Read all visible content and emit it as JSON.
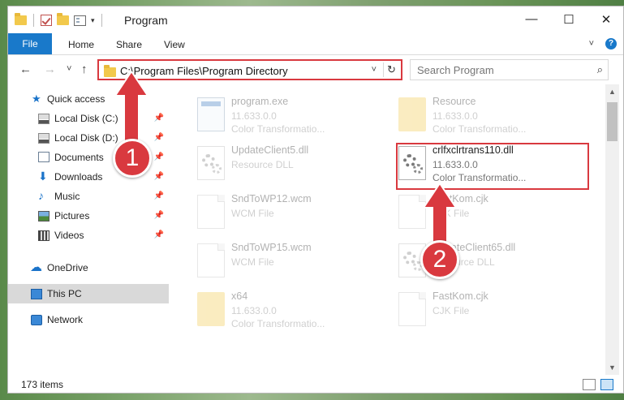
{
  "window": {
    "title": "Program",
    "controls": {
      "minimize": "—",
      "maximize": "☐",
      "close": "✕"
    }
  },
  "ribbon": {
    "file_tab": "File",
    "tabs": [
      "Home",
      "Share",
      "View"
    ]
  },
  "navigation": {
    "back": "←",
    "forward": "→",
    "recent": "˅",
    "up": "↑",
    "address": "C:\\Program Files\\Program Directory",
    "address_dropdown": "˅",
    "refresh": "↻",
    "search_placeholder": "Search Program",
    "search_icon": "⌕"
  },
  "sidebar": {
    "items": [
      {
        "label": "Quick access",
        "icon": "star-icon",
        "pinned": false
      },
      {
        "label": "Local Disk (C:)",
        "icon": "disk-icon",
        "pinned": true
      },
      {
        "label": "Local Disk (D:)",
        "icon": "disk-icon",
        "pinned": true
      },
      {
        "label": "Documents",
        "icon": "documents-icon",
        "pinned": true
      },
      {
        "label": "Downloads",
        "icon": "downloads-icon",
        "pinned": true
      },
      {
        "label": "Music",
        "icon": "music-icon",
        "pinned": true
      },
      {
        "label": "Pictures",
        "icon": "pictures-icon",
        "pinned": true
      },
      {
        "label": "Videos",
        "icon": "videos-icon",
        "pinned": true
      },
      {
        "label": "OneDrive",
        "icon": "onedrive-icon",
        "pinned": false
      },
      {
        "label": "This PC",
        "icon": "this-pc-icon",
        "pinned": false,
        "selected": true
      },
      {
        "label": "Network",
        "icon": "network-icon",
        "pinned": false
      }
    ],
    "pin_glyph": "📌"
  },
  "files": [
    {
      "name": "program.exe",
      "line2": "11.633.0.0",
      "line3": "Color Transformatio...",
      "icon": "exe-icon",
      "faded": true
    },
    {
      "name": "Resource",
      "line2": "11.633.0.0",
      "line3": "Color Transformatio...",
      "icon": "folder-icon",
      "faded": true
    },
    {
      "name": "UpdateClient5.dll",
      "line2": "Resource DLL",
      "line3": "",
      "icon": "gear-file-icon",
      "faded": true
    },
    {
      "name": "crlfxclrtrans110.dll",
      "line2": "11.633.0.0",
      "line3": "Color Transformatio...",
      "icon": "gear-file-icon",
      "faded": false
    },
    {
      "name": "SndToWP12.wcm",
      "line2": "WCM File",
      "line3": "",
      "icon": "file-icon",
      "faded": true
    },
    {
      "name": "FastKom.cjk",
      "line2": "CJK File",
      "line3": "",
      "icon": "file-icon",
      "faded": true
    },
    {
      "name": "SndToWP15.wcm",
      "line2": "WCM File",
      "line3": "",
      "icon": "file-icon",
      "faded": true
    },
    {
      "name": "UpdateClient65.dll",
      "line2": "Resource DLL",
      "line3": "",
      "icon": "gear-file-icon",
      "faded": true
    },
    {
      "name": "x64",
      "line2": "11.633.0.0",
      "line3": "Color Transformatio...",
      "icon": "folder-icon",
      "faded": true
    },
    {
      "name": "FastKom.cjk",
      "line2": "CJK File",
      "line3": "",
      "icon": "file-icon",
      "faded": true
    }
  ],
  "status": {
    "item_count": "173 items"
  },
  "annotations": {
    "step1": "1",
    "step2": "2",
    "color": "#d9393f"
  }
}
